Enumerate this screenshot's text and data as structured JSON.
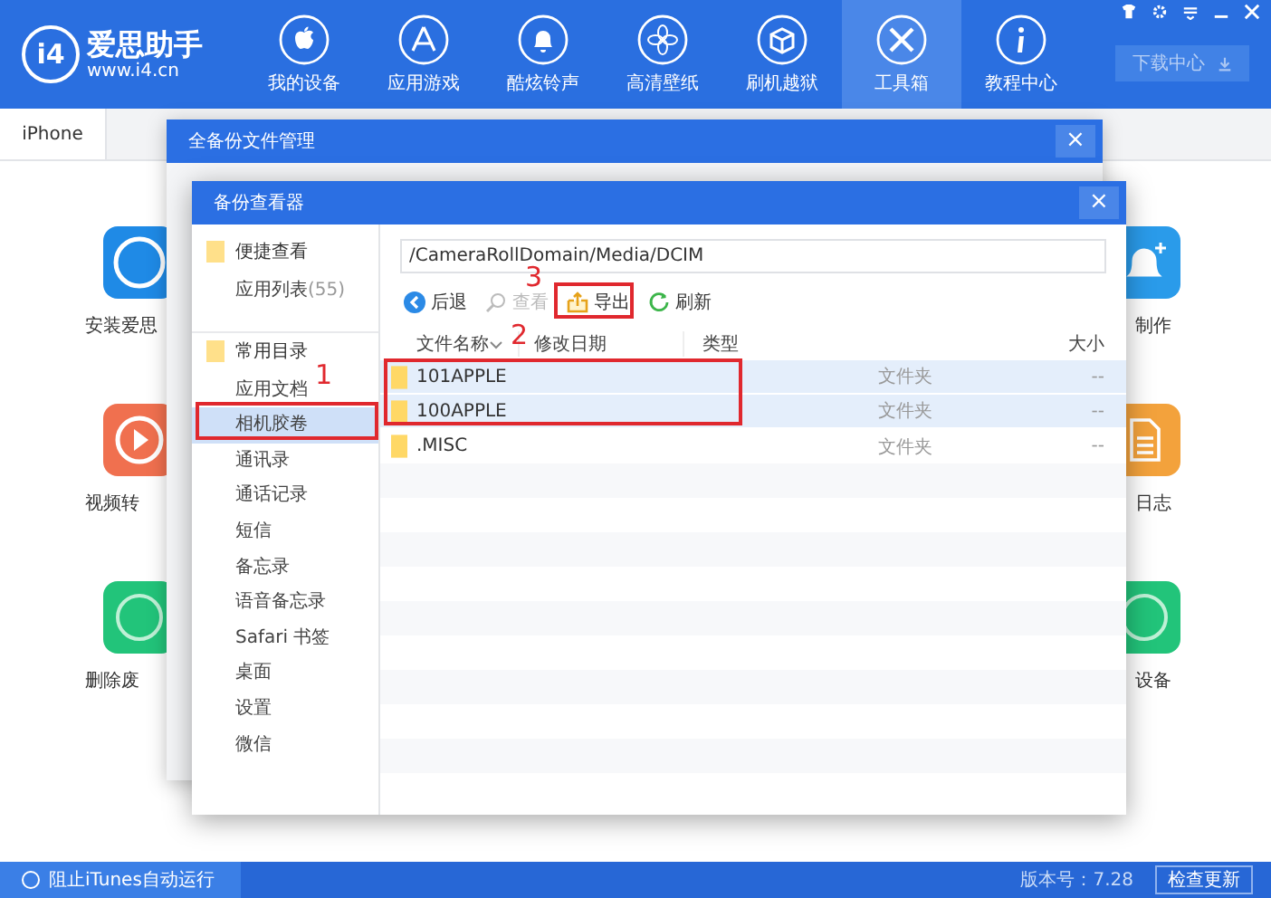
{
  "app": {
    "logo_mark": "i4",
    "name": "爱思助手",
    "url": "www.i4.cn"
  },
  "nav": [
    {
      "label": "我的设备",
      "selected": false
    },
    {
      "label": "应用游戏",
      "selected": false
    },
    {
      "label": "酷炫铃声",
      "selected": false
    },
    {
      "label": "高清壁纸",
      "selected": false
    },
    {
      "label": "刷机越狱",
      "selected": false
    },
    {
      "label": "工具箱",
      "selected": true
    },
    {
      "label": "教程中心",
      "selected": false
    }
  ],
  "download_button": "下载中心",
  "device_tabs": [
    {
      "label": "iPhone",
      "selected": true
    }
  ],
  "tools_left": [
    {
      "label": "安装爱思",
      "color": "#1f8ae6"
    },
    {
      "label": "视频转",
      "color": "#f0704f"
    },
    {
      "label": "删除废",
      "color": "#22c47a"
    }
  ],
  "tools_right": [
    {
      "label": "制作",
      "color": "#2a9bea"
    },
    {
      "label": "日志",
      "color": "#f3a23c"
    },
    {
      "label": "设备",
      "color": "#22c47a"
    }
  ],
  "outer_dialog": {
    "title": "全备份文件管理",
    "close": "×"
  },
  "viewer": {
    "title": "备份查看器",
    "close": "×",
    "sidebar": [
      {
        "label": "便捷查看",
        "children": [
          {
            "label": "应用列表",
            "count": "(55)",
            "selected": false
          }
        ]
      },
      {
        "label": "常用目录",
        "children": [
          {
            "label": "应用文档",
            "selected": false
          },
          {
            "label": "相机胶卷",
            "selected": true
          },
          {
            "label": "通讯录",
            "selected": false
          },
          {
            "label": "通话记录",
            "selected": false
          },
          {
            "label": "短信",
            "selected": false
          },
          {
            "label": "备忘录",
            "selected": false
          },
          {
            "label": "语音备忘录",
            "selected": false
          },
          {
            "label": "Safari 书签",
            "selected": false
          },
          {
            "label": "桌面",
            "selected": false
          },
          {
            "label": "设置",
            "selected": false
          },
          {
            "label": "微信",
            "selected": false
          }
        ]
      }
    ],
    "path": "/CameraRollDomain/Media/DCIM",
    "toolbar": [
      {
        "label": "后退",
        "disabled": false
      },
      {
        "label": "查看",
        "disabled": true
      },
      {
        "label": "导出",
        "disabled": false
      },
      {
        "label": "刷新",
        "disabled": false
      }
    ],
    "columns": [
      "文件名称",
      "修改日期",
      "类型",
      "大小"
    ],
    "rows": [
      {
        "name": "101APPLE",
        "type": "文件夹",
        "size": "--",
        "selected": true
      },
      {
        "name": "100APPLE",
        "type": "文件夹",
        "size": "--",
        "selected": true
      },
      {
        "name": ".MISC",
        "type": "文件夹",
        "size": "--",
        "selected": false
      }
    ]
  },
  "annotations": [
    {
      "number": "1"
    },
    {
      "number": "2"
    },
    {
      "number": "3"
    }
  ],
  "status_bar": {
    "itunes_toggle": {
      "label": "阻止iTunes自动运行",
      "checked": false
    },
    "version": "版本号：7.28",
    "update_button": "检查更新"
  }
}
